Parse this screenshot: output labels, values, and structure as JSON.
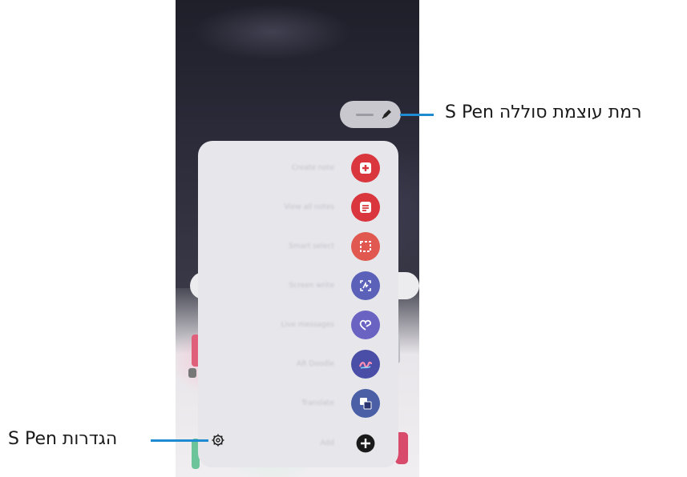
{
  "callouts": {
    "scroll_label": "רמת עוצמת סוללה S Pen",
    "settings_label": "הגדרות S Pen"
  },
  "colors": {
    "callout_line": "#1f8bd1",
    "red": "#d9363e",
    "blue_purple": "#5b61b8"
  },
  "menu": {
    "items": [
      {
        "label": "Create note",
        "icon": "create-note-icon",
        "color": "#d9363e"
      },
      {
        "label": "View all notes",
        "icon": "view-notes-icon",
        "color": "#d9363e"
      },
      {
        "label": "Smart select",
        "icon": "smart-select-icon",
        "color": "#e0584f"
      },
      {
        "label": "Screen write",
        "icon": "screen-write-icon",
        "color": "#5b61b8"
      },
      {
        "label": "Live messages",
        "icon": "live-messages-icon",
        "color": "#6a63c2"
      },
      {
        "label": "AR Doodle",
        "icon": "ar-doodle-icon",
        "color": "#4a4ea6"
      },
      {
        "label": "Translate",
        "icon": "translate-icon",
        "color": "#4b5fa6"
      },
      {
        "label": "Add",
        "icon": "add-icon",
        "color": "#1a1a1a"
      }
    ]
  }
}
